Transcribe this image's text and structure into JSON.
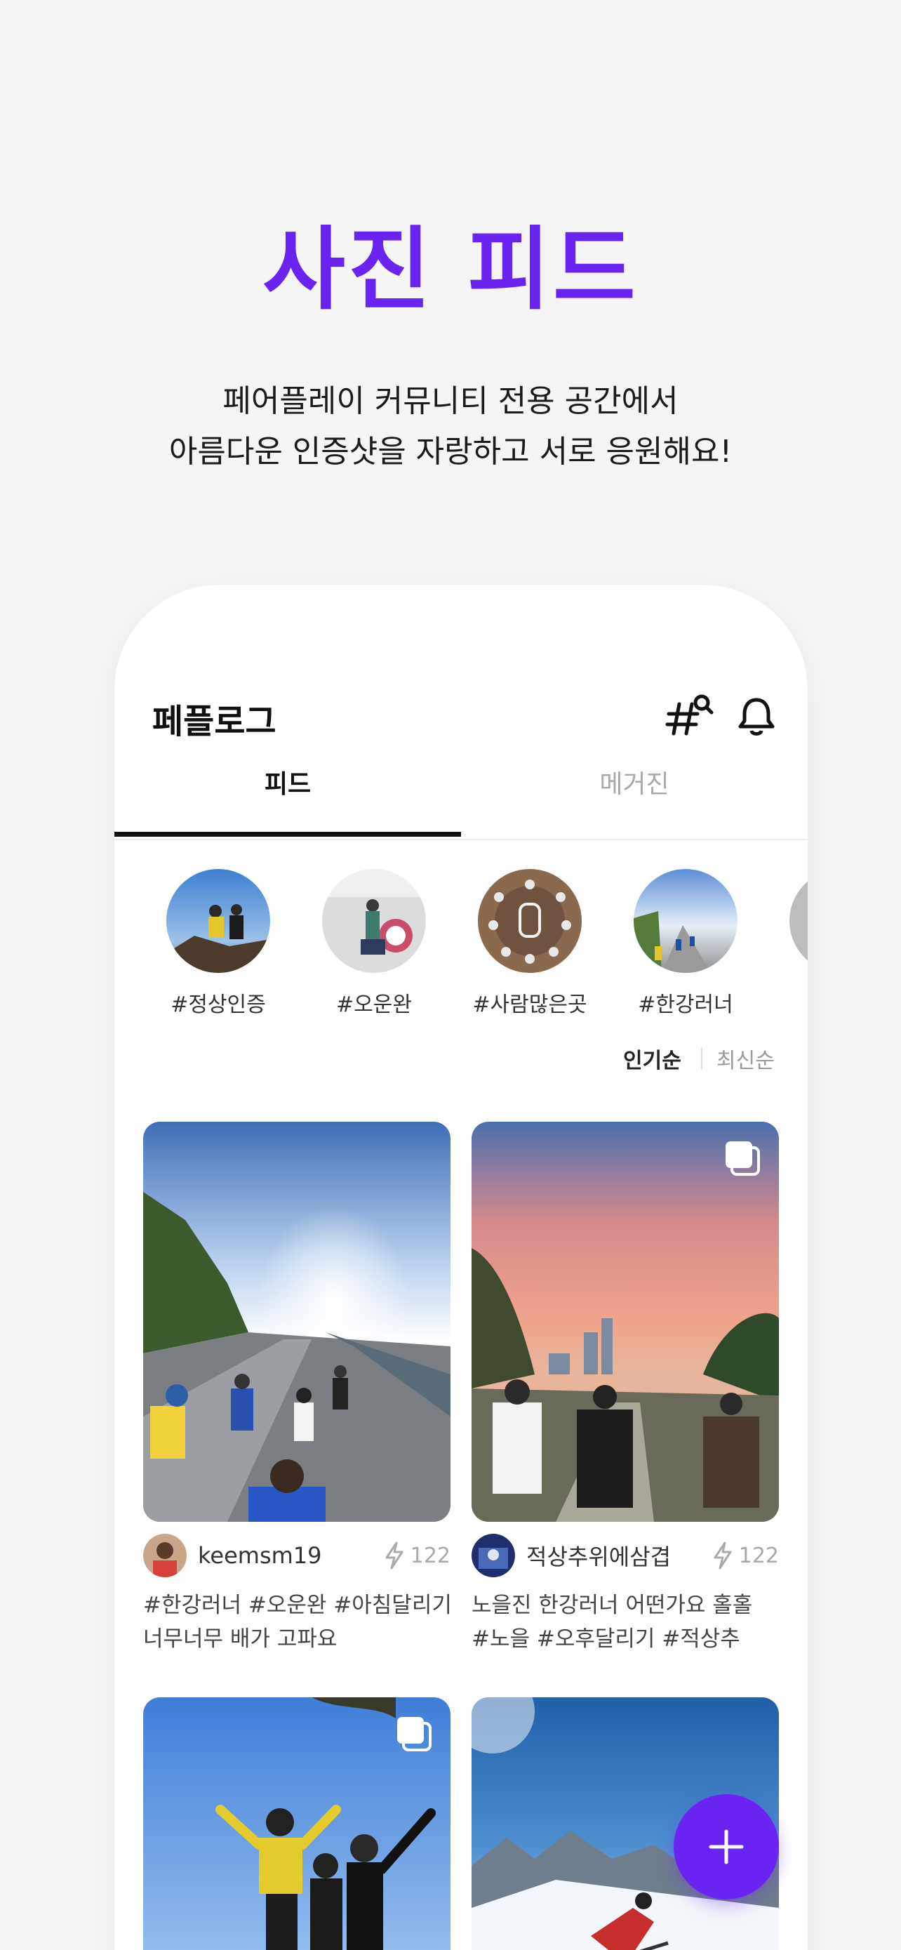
{
  "promo": {
    "headline": "사진 피드",
    "subtitle_line1": "페어플레이 커뮤니티 전용 공간에서",
    "subtitle_line2": "아름다운 인증샷을 자랑하고 서로 응원해요!"
  },
  "app": {
    "title": "페플로그",
    "tabs": [
      {
        "label": "피드",
        "active": true
      },
      {
        "label": "메거진",
        "active": false
      }
    ],
    "hashtags": [
      {
        "label": "#정상인증"
      },
      {
        "label": "#오운완"
      },
      {
        "label": "#사람많은곳"
      },
      {
        "label": "#한강러너"
      },
      {
        "label": "#"
      }
    ],
    "sort": {
      "popular": "인기순",
      "latest": "최신순",
      "selected": "인기순"
    },
    "posts": [
      {
        "username": "keemsm19",
        "likes": "122",
        "caption_line1": "#한강러너 #오운완 #아침달리기",
        "caption_line2": "너무너무 배가 고파요",
        "multi_photo": false
      },
      {
        "username": "적상추위에삼겹",
        "likes": "122",
        "caption_line1": " 노을진 한강러너 어떤가요 홀홀",
        "caption_line2": "#노을 #오후달리기 #적상추",
        "multi_photo": true
      },
      {
        "username": "",
        "likes": "",
        "caption_line1": "",
        "caption_line2": "",
        "multi_photo": true
      },
      {
        "username": "",
        "likes": "",
        "caption_line1": "",
        "caption_line2": "",
        "multi_photo": false
      }
    ]
  },
  "icons": {
    "hashtag_search": "hashtag-search-icon",
    "notification": "bell-icon",
    "likes": "lightning-icon",
    "multi_photo": "stacked-photos-icon",
    "compose": "plus-icon"
  },
  "colors": {
    "brand": "#6a24f2",
    "background": "#f5f5f6"
  }
}
